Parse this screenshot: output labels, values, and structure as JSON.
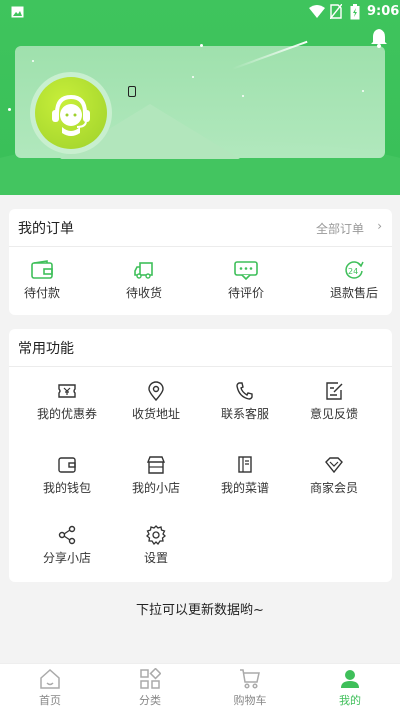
{
  "status_bar": {
    "time": "9:06"
  },
  "orders": {
    "title": "我的订单",
    "all_label": "全部订单",
    "items": [
      {
        "label": "待付款",
        "icon": "wallet-icon"
      },
      {
        "label": "待收货",
        "icon": "truck-icon"
      },
      {
        "label": "待评价",
        "icon": "comment-icon"
      },
      {
        "label": "退款售后",
        "icon": "24h-service-icon"
      }
    ]
  },
  "functions": {
    "title": "常用功能",
    "items": [
      {
        "label": "我的优惠券",
        "icon": "coupon-icon"
      },
      {
        "label": "收货地址",
        "icon": "location-pin-icon"
      },
      {
        "label": "联系客服",
        "icon": "phone-icon"
      },
      {
        "label": "意见反馈",
        "icon": "edit-note-icon"
      },
      {
        "label": "我的钱包",
        "icon": "wallet-icon"
      },
      {
        "label": "我的小店",
        "icon": "store-icon"
      },
      {
        "label": "我的菜谱",
        "icon": "book-icon"
      },
      {
        "label": "商家会员",
        "icon": "diamond-icon"
      },
      {
        "label": "分享小店",
        "icon": "share-icon"
      },
      {
        "label": "设置",
        "icon": "gear-icon"
      }
    ]
  },
  "pull_hint": "下拉可以更新数据哟~",
  "tabbar": {
    "items": [
      {
        "label": "首页",
        "icon": "home-icon",
        "active": false
      },
      {
        "label": "分类",
        "icon": "category-icon",
        "active": false
      },
      {
        "label": "购物车",
        "icon": "cart-icon",
        "active": false
      },
      {
        "label": "我的",
        "icon": "user-icon",
        "active": true
      }
    ]
  },
  "colors": {
    "brand_green": "#3fc45d",
    "active_tab": "#3fbf5a"
  }
}
